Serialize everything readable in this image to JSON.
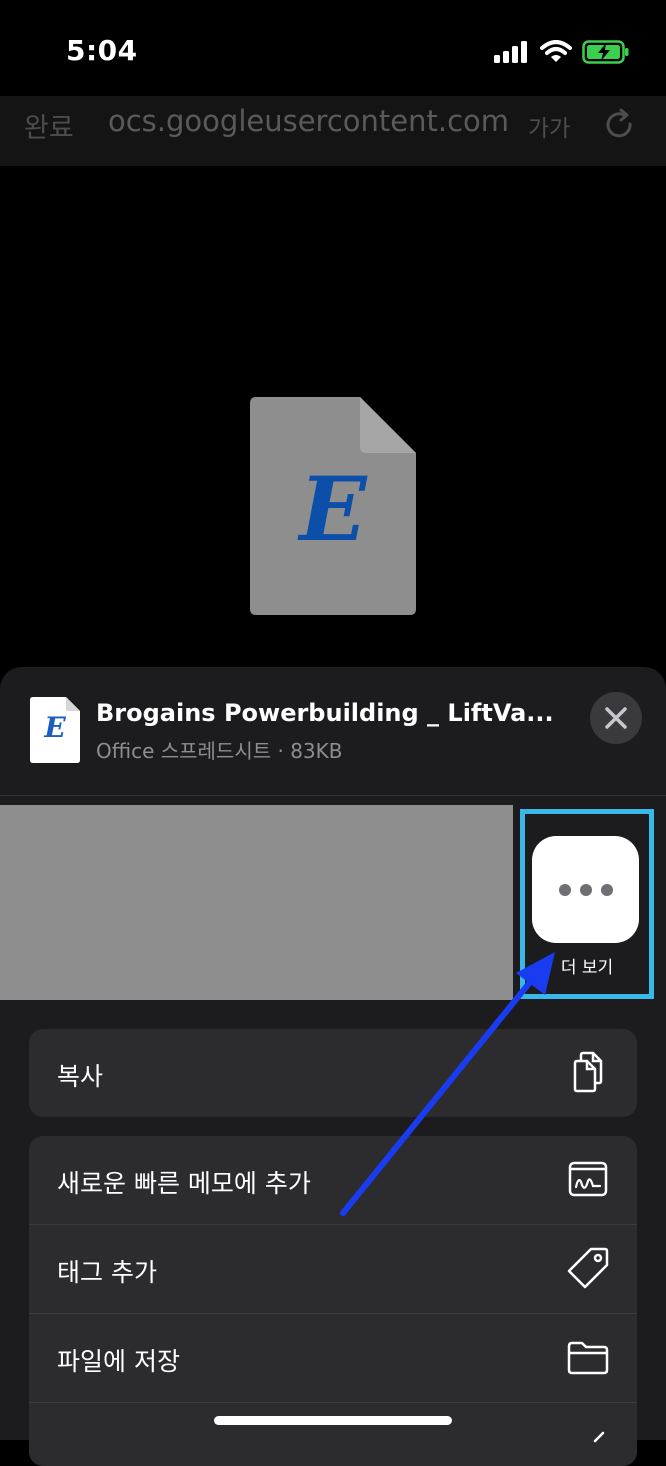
{
  "status_bar": {
    "time": "5:04"
  },
  "browser_bar": {
    "done_label": "완료",
    "url": "ocs.googleusercontent.com",
    "text_size_label": "가가"
  },
  "preview": {
    "icon_letter": "E"
  },
  "sheet": {
    "file_title": "Brogains Powerbuilding _ LiftVa...",
    "file_subtitle": "Office 스프레드시트 · 83KB",
    "file_icon_letter": "E",
    "more_label": "더 보기"
  },
  "actions": {
    "copy": "복사",
    "quick_note": "새로운 빠른 메모에 추가",
    "add_tags": "태그 추가",
    "save_to_files": "파일에 저장"
  },
  "colors": {
    "sheet_background": "#1c1c1e",
    "row_background": "#2c2c2e",
    "highlight": "#38b7e8",
    "annotation_arrow": "#1a3cf0",
    "excel_letter": "#1a5fc0"
  }
}
